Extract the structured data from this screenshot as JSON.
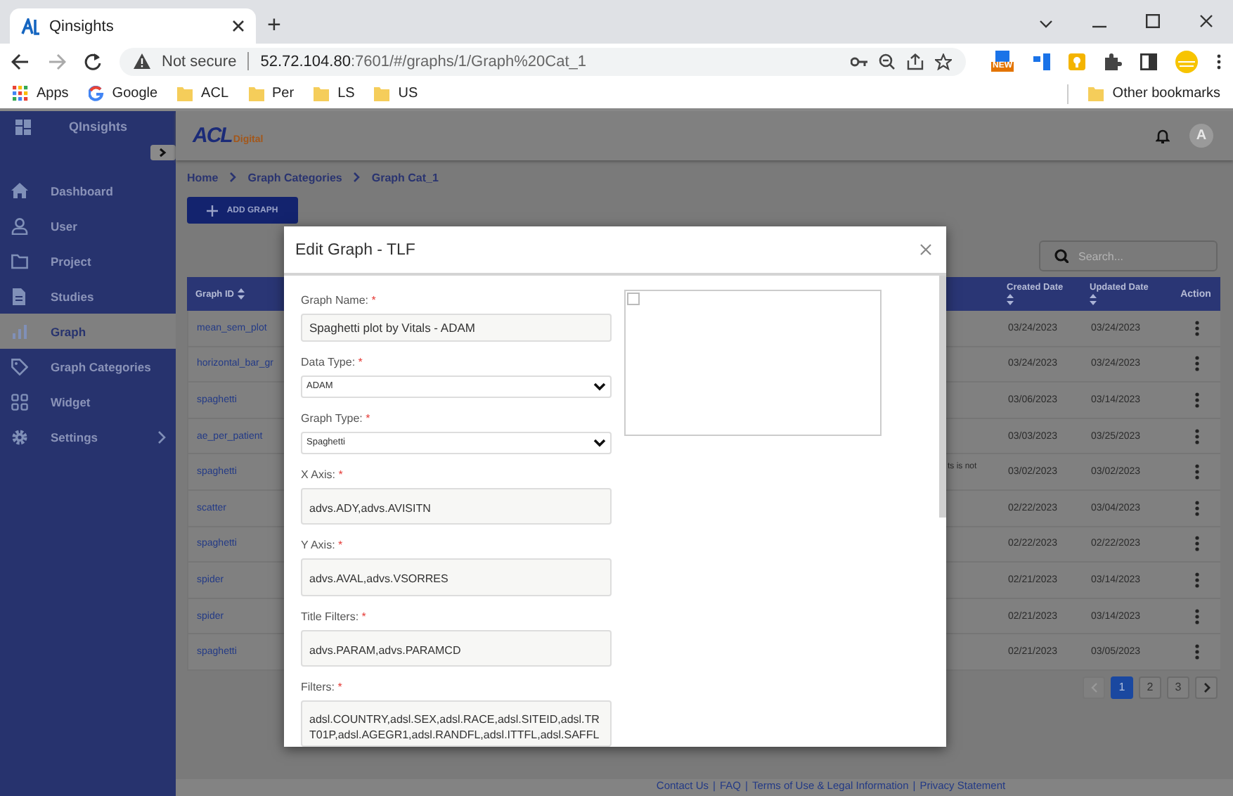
{
  "browser": {
    "tab_title": "Qinsights",
    "new_tab": "+",
    "security": "Not secure",
    "url_host": "52.72.104.80",
    "url_rest": ":7601/#/graphs/1/Graph%20Cat_1",
    "extension_badge": "NEW",
    "bookmarks": [
      {
        "label": "Apps",
        "kind": "apps"
      },
      {
        "label": "Google",
        "kind": "google"
      },
      {
        "label": "ACL",
        "kind": "folder"
      },
      {
        "label": "Per",
        "kind": "folder"
      },
      {
        "label": "LS",
        "kind": "folder"
      },
      {
        "label": "US",
        "kind": "folder"
      }
    ],
    "other_bookmarks": "Other bookmarks"
  },
  "sidebar": {
    "brand": "QInsights",
    "items": [
      {
        "label": "Dashboard",
        "selected": false,
        "submenu": false
      },
      {
        "label": "User",
        "selected": false,
        "submenu": false
      },
      {
        "label": "Project",
        "selected": false,
        "submenu": false
      },
      {
        "label": "Studies",
        "selected": false,
        "submenu": false
      },
      {
        "label": "Graph",
        "selected": true,
        "submenu": false
      },
      {
        "label": "Graph Categories",
        "selected": false,
        "submenu": false
      },
      {
        "label": "Widget",
        "selected": false,
        "submenu": false
      },
      {
        "label": "Settings",
        "selected": false,
        "submenu": true
      }
    ]
  },
  "header": {
    "logo_mark": "ACL",
    "logo_word": "Digital",
    "avatar": "A"
  },
  "breadcrumb": [
    "Home",
    "Graph Categories",
    "Graph Cat_1"
  ],
  "add_button": "ADD GRAPH",
  "search": {
    "placeholder": "Search..."
  },
  "table": {
    "columns": [
      {
        "label": "Graph ID",
        "sortable": true
      },
      {
        "label": "Created Date",
        "sortable": true
      },
      {
        "label": "Updated Date",
        "sortable": true
      },
      {
        "label": "Action",
        "sortable": false
      }
    ],
    "rows": [
      {
        "graph_id": "mean_sem_plot",
        "created": "03/24/2023",
        "updated": "03/24/2023"
      },
      {
        "graph_id": "horizontal_bar_gr",
        "created": "03/24/2023",
        "updated": "03/24/2023"
      },
      {
        "graph_id": "spaghetti",
        "created": "03/06/2023",
        "updated": "03/14/2023"
      },
      {
        "graph_id": "ae_per_patient",
        "created": "03/03/2023",
        "updated": "03/25/2023"
      },
      {
        "graph_id": "spaghetti",
        "column_3": "ts is not",
        "created": "03/02/2023",
        "updated": "03/02/2023"
      },
      {
        "graph_id": "scatter",
        "created": "02/22/2023",
        "updated": "03/04/2023"
      },
      {
        "graph_id": "spaghetti",
        "created": "02/22/2023",
        "updated": "02/22/2023"
      },
      {
        "graph_id": "spider",
        "created": "02/21/2023",
        "updated": "03/14/2023"
      },
      {
        "graph_id": "spider",
        "created": "02/21/2023",
        "updated": "03/14/2023"
      },
      {
        "graph_id": "spaghetti",
        "created": "02/21/2023",
        "updated": "03/05/2023"
      }
    ]
  },
  "pagination": {
    "prev_disabled": true,
    "pages": [
      {
        "label": "1",
        "selected": true
      },
      {
        "label": "2",
        "selected": false
      },
      {
        "label": "3",
        "selected": false
      }
    ]
  },
  "footer": {
    "separator": "|",
    "links": [
      "Contact Us",
      "FAQ",
      "Terms of Use & Legal Information",
      "Privacy Statement"
    ]
  },
  "modal": {
    "title": "Edit Graph - TLF",
    "fields": [
      {
        "label": "Graph Name:",
        "mark": "*",
        "kind": "text",
        "value": "Spaghetti plot by Vitals - ADAM"
      },
      {
        "label": "Data Type:",
        "mark": "*",
        "kind": "select",
        "value": "ADAM"
      },
      {
        "label": "Graph Type:",
        "mark": "*",
        "kind": "select",
        "value": "Spaghetti"
      },
      {
        "label": "X Axis:",
        "mark": "*",
        "kind": "textarea",
        "value": "advs.ADY,advs.AVISITN"
      },
      {
        "label": "Y Axis:",
        "mark": "*",
        "kind": "textarea",
        "value": "advs.AVAL,advs.VSORRES"
      },
      {
        "label": "Title Filters:",
        "mark": "*",
        "kind": "textarea",
        "value": "advs.PARAM,advs.PARAMCD"
      },
      {
        "label": "Filters:",
        "mark": "*",
        "kind": "textarea",
        "value": "adsl.COUNTRY,adsl.SEX,adsl.RACE,adsl.SITEID,adsl.TRT01P,adsl.AGEGR1,adsl.RANDFL,adsl.ITTFL,adsl.SAFFL"
      }
    ]
  }
}
